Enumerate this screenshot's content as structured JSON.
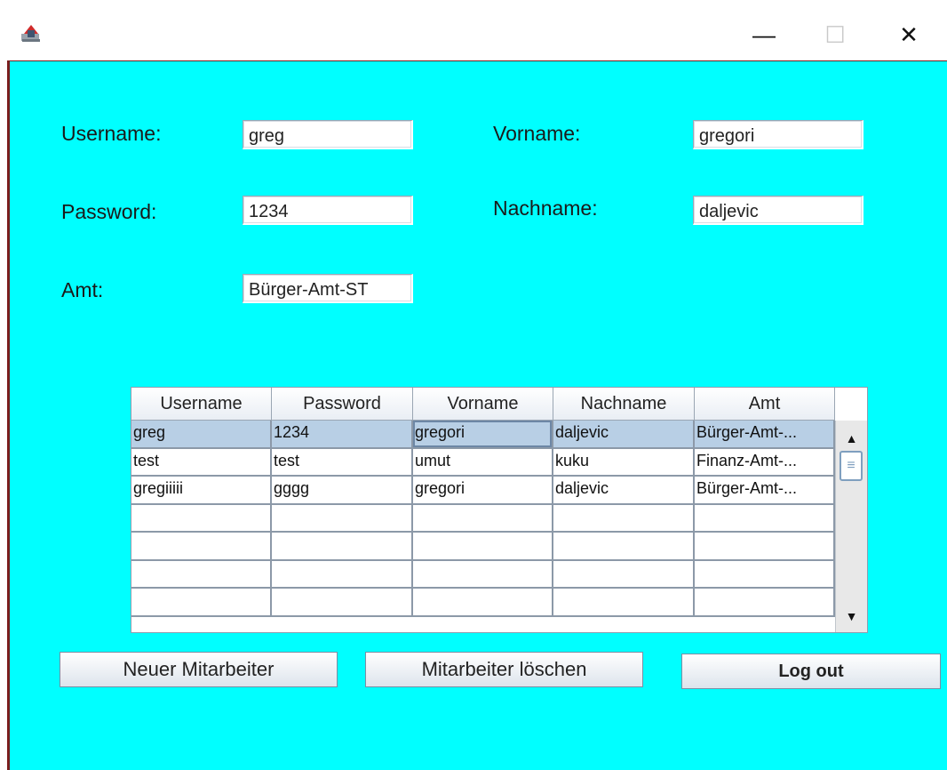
{
  "window": {
    "icon": "java-app-icon",
    "controls": {
      "minimize": "—",
      "maximize": "☐",
      "close": "✕"
    }
  },
  "form": {
    "username_label": "Username:",
    "username_value": "greg",
    "password_label": "Password:",
    "password_value": "1234",
    "amt_label": "Amt:",
    "amt_value": "Bürger-Amt-ST",
    "vorname_label": "Vorname:",
    "vorname_value": "gregori",
    "nachname_label": "Nachname:",
    "nachname_value": "daljevic"
  },
  "table": {
    "columns": [
      "Username",
      "Password",
      "Vorname",
      "Nachname",
      "Amt"
    ],
    "rows": [
      [
        "greg",
        "1234",
        "gregori",
        "daljevic",
        "Bürger-Amt-..."
      ],
      [
        "test",
        "test",
        "umut",
        "kuku",
        "Finanz-Amt-..."
      ],
      [
        "gregiiiii",
        "gggg",
        "gregori",
        "daljevic",
        "Bürger-Amt-..."
      ],
      [
        "",
        "",
        "",
        "",
        ""
      ],
      [
        "",
        "",
        "",
        "",
        ""
      ],
      [
        "",
        "",
        "",
        "",
        ""
      ],
      [
        "",
        "",
        "",
        "",
        ""
      ]
    ],
    "selected_row": 0,
    "scroll_up": "▲",
    "scroll_down": "▼",
    "scroll_grip": "≡"
  },
  "buttons": {
    "new_label": "Neuer Mitarbeiter",
    "delete_label": "Mitarbeiter löschen",
    "logout_label": "Log out"
  },
  "colors": {
    "background": "#00ffff",
    "selection": "#b8cfe5"
  }
}
